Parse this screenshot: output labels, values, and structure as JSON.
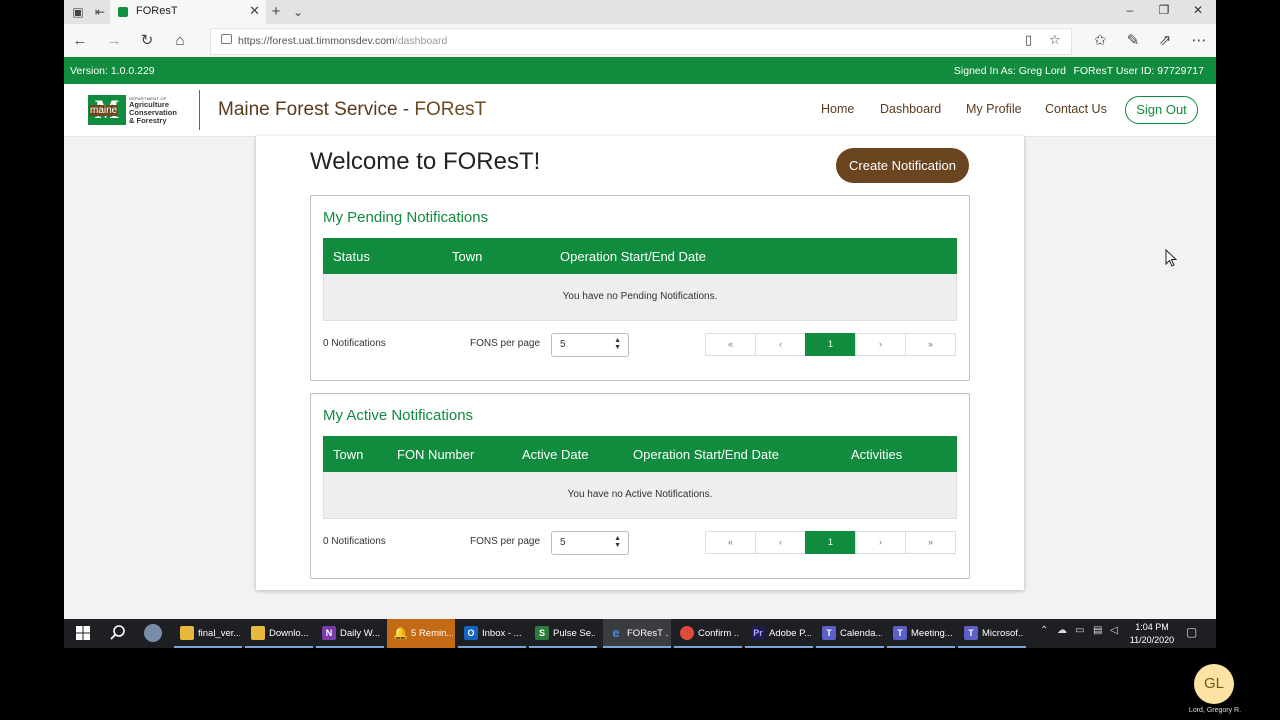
{
  "browser": {
    "tab_title": "FOResT",
    "url_host": "https://forest.uat.timmonsdev.com",
    "url_path": "/dashboard"
  },
  "site": {
    "version": "Version: 1.0.0.229",
    "signed_in": "Signed In As: Greg Lord",
    "user_id": "FOResT User ID: 97729717",
    "logo": {
      "letter": "M",
      "word": "maine",
      "dept": "DEPARTMENT OF",
      "line1": "Agriculture",
      "line2": "Conservation",
      "line3": "& Forestry"
    },
    "title": "Maine Forest Service",
    "title_sep": " - ",
    "title_sub": "FOResT",
    "nav": {
      "home": "Home",
      "dashboard": "Dashboard",
      "profile": "My Profile",
      "contact": "Contact Us",
      "sign_out": "Sign Out"
    },
    "accent": "#118b3e",
    "brown": "#6b4520"
  },
  "dashboard": {
    "welcome": "Welcome to FOResT!",
    "create_button": "Create Notification",
    "pending": {
      "title": "My Pending Notifications",
      "columns": [
        "Status",
        "Town",
        "Operation Start/End Date"
      ],
      "empty": "You have no Pending Notifications.",
      "count": "0 Notifications",
      "per_page_label": "FONS per page",
      "per_page": "5",
      "pager": [
        "«",
        "‹",
        "1",
        "›",
        "»"
      ]
    },
    "active": {
      "title": "My Active Notifications",
      "columns": [
        "Town",
        "FON Number",
        "Active Date",
        "Operation Start/End Date",
        "Activities"
      ],
      "empty": "You have no Active Notifications.",
      "count": "0 Notifications",
      "per_page_label": "FONS per page",
      "per_page": "5",
      "pager": [
        "«",
        "‹",
        "1",
        "›",
        "»"
      ]
    }
  },
  "taskbar": {
    "items": [
      "final_ver...",
      "Downlo...",
      "Daily W...",
      "5 Remin...",
      "Inbox - ...",
      "Pulse Se...",
      "FOResT ...",
      "Confirm ...",
      "Adobe P...",
      "Calenda...",
      "Meeting...",
      "Microsof..."
    ],
    "time": "1:04 PM",
    "date": "11/20/2020"
  },
  "video": {
    "avatar_initials": "GL",
    "name": "Lord, Gregory R."
  }
}
